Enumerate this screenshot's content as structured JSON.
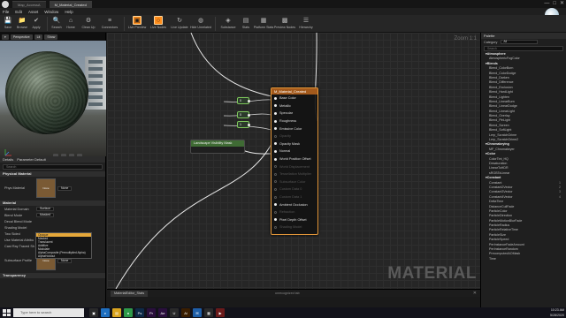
{
  "titlebar": {
    "tabs": [
      "Map_AccessA",
      "M_Material_Created"
    ],
    "controls": [
      "—",
      "□",
      "✕"
    ]
  },
  "menu": [
    "File",
    "Edit",
    "Asset",
    "Window",
    "Help"
  ],
  "toolbar": {
    "buttons": [
      {
        "label": "Save",
        "icon": "save-icon",
        "glyph": "💾",
        "hl": false
      },
      {
        "label": "Browse",
        "icon": "folder-icon",
        "glyph": "📁",
        "hl": false
      },
      {
        "label": "Apply",
        "icon": "apply-icon",
        "glyph": "✔",
        "hl": false
      },
      {
        "label": "Search",
        "icon": "search-icon",
        "glyph": "🔍",
        "hl": false
      },
      {
        "label": "Home",
        "icon": "home-icon",
        "glyph": "⌂",
        "hl": false
      },
      {
        "label": "Clean Up",
        "icon": "cleanup-icon",
        "glyph": "⚙",
        "hl": false
      },
      {
        "label": "Connectors",
        "icon": "connectors-icon",
        "glyph": "≡",
        "hl": false
      },
      {
        "label": "Live Preview",
        "icon": "live-preview-icon",
        "glyph": "▣",
        "hl": true
      },
      {
        "label": "Live Nodes",
        "icon": "live-nodes-icon",
        "glyph": "○",
        "hl": true
      },
      {
        "label": "Live Update",
        "icon": "live-update-icon",
        "glyph": "↻",
        "hl": false
      },
      {
        "label": "Hide Unrelated",
        "icon": "hide-unrelated-icon",
        "glyph": "◍",
        "hl": false
      },
      {
        "label": "Substance",
        "icon": "substance-icon",
        "glyph": "◈",
        "hl": false
      },
      {
        "label": "Stats",
        "icon": "stats-icon",
        "glyph": "▤",
        "hl": false
      },
      {
        "label": "Platform Stats",
        "icon": "platform-stats-icon",
        "glyph": "▦",
        "hl": false
      },
      {
        "label": "Preview Nodes",
        "icon": "preview-nodes-icon",
        "glyph": "▩",
        "hl": false
      },
      {
        "label": "Hierarchy",
        "icon": "hierarchy-icon",
        "glyph": "☰",
        "hl": false
      }
    ]
  },
  "viewport": {
    "buttons": [
      "▾",
      "Perspective",
      "Lit",
      "Show"
    ]
  },
  "details": {
    "tabs": [
      "Details",
      "Parameter Default"
    ],
    "search_placeholder": "Search",
    "sections": {
      "physical": "Physical Material",
      "material": "Material",
      "transparency": "Transparency"
    },
    "phys_label": "Phys Material",
    "phys_thumb": "None",
    "phys_value": "None",
    "rows": [
      {
        "label": "Material Domain",
        "value": "Surface"
      },
      {
        "label": "Blend Mode",
        "value": "Masked"
      },
      {
        "label": "Decal Blend Mode",
        "value": ""
      },
      {
        "label": "Shading Model",
        "value": ""
      },
      {
        "label": "Two Sided",
        "value": ""
      },
      {
        "label": "Use Material Attribu",
        "value": ""
      },
      {
        "label": "Cast Ray Traced Sh",
        "value": ""
      }
    ],
    "dropdown": [
      "Opaque",
      "Masked",
      "Translucent",
      "Additive",
      "Modulate",
      "AlphaComposite (Premultiplied Alpha)",
      "AlphaHoldout"
    ],
    "subsurface_label": "Subsurface Profile",
    "subsurface_thumb": "None",
    "subsurface_value": "None"
  },
  "graph": {
    "zoom": "Zoom 1:1",
    "watermark": "MATERIAL",
    "node_title": "M_Material_Created",
    "pins": [
      {
        "name": "Base Color",
        "on": true
      },
      {
        "name": "Metallic",
        "on": true
      },
      {
        "name": "Specular",
        "on": true
      },
      {
        "name": "Roughness",
        "on": true
      },
      {
        "name": "Emissive Color",
        "on": true
      },
      {
        "name": "Opacity",
        "on": false
      },
      {
        "name": "Opacity Mask",
        "on": true
      },
      {
        "name": "Normal",
        "on": true
      },
      {
        "name": "World Position Offset",
        "on": true
      },
      {
        "name": "World Displacement",
        "on": false
      },
      {
        "name": "Tessellation Multiplier",
        "on": false
      },
      {
        "name": "Subsurface Color",
        "on": false
      },
      {
        "name": "Custom Data 0",
        "on": false
      },
      {
        "name": "Custom Data 1",
        "on": false
      },
      {
        "name": "Ambient Occlusion",
        "on": true
      },
      {
        "name": "Refraction",
        "on": false
      },
      {
        "name": "Pixel Depth Offset",
        "on": true
      },
      {
        "name": "Shading Model",
        "on": false
      }
    ],
    "const_nodes": [
      "0",
      "0",
      "1"
    ],
    "mask_node_title": "Landscape Visibility Mask",
    "tab": "MaterialEditor_Stats",
    "center_text": "unrecognized tab"
  },
  "palette": {
    "tab": "Palette",
    "category_label": "Category",
    "category_value": "All",
    "search_placeholder": "Search",
    "items": [
      {
        "name": "▾Atmosphere",
        "cat": true,
        "key": ""
      },
      {
        "name": "AtmosphericFogColor",
        "cat": false,
        "key": ""
      },
      {
        "name": "▾Blends",
        "cat": true,
        "key": ""
      },
      {
        "name": "Blend_ColorBurn",
        "cat": false,
        "key": ""
      },
      {
        "name": "Blend_ColorDodge",
        "cat": false,
        "key": ""
      },
      {
        "name": "Blend_Darken",
        "cat": false,
        "key": ""
      },
      {
        "name": "Blend_Difference",
        "cat": false,
        "key": ""
      },
      {
        "name": "Blend_Exclusion",
        "cat": false,
        "key": ""
      },
      {
        "name": "Blend_HardLight",
        "cat": false,
        "key": ""
      },
      {
        "name": "Blend_Lighten",
        "cat": false,
        "key": ""
      },
      {
        "name": "Blend_LinearBurn",
        "cat": false,
        "key": ""
      },
      {
        "name": "Blend_LinearDodge",
        "cat": false,
        "key": ""
      },
      {
        "name": "Blend_LinearLight",
        "cat": false,
        "key": ""
      },
      {
        "name": "Blend_Overlay",
        "cat": false,
        "key": ""
      },
      {
        "name": "Blend_PinLight",
        "cat": false,
        "key": ""
      },
      {
        "name": "Blend_Screen",
        "cat": false,
        "key": ""
      },
      {
        "name": "Blend_SoftLight",
        "cat": false,
        "key": ""
      },
      {
        "name": "Lerp_ScratchGrime",
        "cat": false,
        "key": ""
      },
      {
        "name": "Lerp_ScratchGrime2",
        "cat": false,
        "key": ""
      },
      {
        "name": "▾Chromakeying",
        "cat": true,
        "key": ""
      },
      {
        "name": "MF_Chromakeyer",
        "cat": false,
        "key": ""
      },
      {
        "name": "▾Color",
        "cat": true,
        "key": ""
      },
      {
        "name": "ColorTint_HQ",
        "cat": false,
        "key": ""
      },
      {
        "name": "Desaturation",
        "cat": false,
        "key": ""
      },
      {
        "name": "LinearToHDR",
        "cat": false,
        "key": ""
      },
      {
        "name": "sRGBToLinear",
        "cat": false,
        "key": ""
      },
      {
        "name": "▾Constant",
        "cat": true,
        "key": ""
      },
      {
        "name": "Constant",
        "cat": false,
        "key": "1"
      },
      {
        "name": "Constant2Vector",
        "cat": false,
        "key": "2"
      },
      {
        "name": "Constant3Vector",
        "cat": false,
        "key": "3"
      },
      {
        "name": "Constant4Vector",
        "cat": false,
        "key": "4"
      },
      {
        "name": "DeltaTime",
        "cat": false,
        "key": ""
      },
      {
        "name": "DistanceCullFade",
        "cat": false,
        "key": ""
      },
      {
        "name": "ParticleColor",
        "cat": false,
        "key": ""
      },
      {
        "name": "ParticleDirection",
        "cat": false,
        "key": ""
      },
      {
        "name": "ParticleMotionBlurFade",
        "cat": false,
        "key": ""
      },
      {
        "name": "ParticleRadius",
        "cat": false,
        "key": ""
      },
      {
        "name": "ParticleRelativeTime",
        "cat": false,
        "key": ""
      },
      {
        "name": "ParticleSize",
        "cat": false,
        "key": ""
      },
      {
        "name": "ParticleSpeed",
        "cat": false,
        "key": ""
      },
      {
        "name": "PerInstanceFadeAmount",
        "cat": false,
        "key": ""
      },
      {
        "name": "PerInstanceRandom",
        "cat": false,
        "key": ""
      },
      {
        "name": "PrecomputedAOMask",
        "cat": false,
        "key": ""
      },
      {
        "name": "Time",
        "cat": false,
        "key": ""
      }
    ]
  },
  "taskbar": {
    "search_placeholder": "Type here to search",
    "apps": [
      {
        "icon": "task-view-icon",
        "glyph": "▣",
        "color": "#2a2a2a"
      },
      {
        "icon": "edge-icon",
        "glyph": "e",
        "color": "#1f6fbf"
      },
      {
        "icon": "explorer-icon",
        "glyph": "▤",
        "color": "#d9a420"
      },
      {
        "icon": "chrome-icon",
        "glyph": "●",
        "color": "#2f9a4a"
      },
      {
        "icon": "photoshop-icon",
        "glyph": "Ps",
        "color": "#0e2a47"
      },
      {
        "icon": "premiere-icon",
        "glyph": "Pr",
        "color": "#2a0f3d"
      },
      {
        "icon": "aftereffects-icon",
        "glyph": "Ae",
        "color": "#2a0f3d"
      },
      {
        "icon": "unreal-icon",
        "glyph": "U",
        "color": "#2a2a2a"
      },
      {
        "icon": "illustrator-icon",
        "glyph": "Ai",
        "color": "#3a1e00"
      },
      {
        "icon": "mail-icon",
        "glyph": "✉",
        "color": "#1f5fa8"
      },
      {
        "icon": "store-icon",
        "glyph": "▦",
        "color": "#2a2a2a"
      },
      {
        "icon": "media-icon",
        "glyph": "▶",
        "color": "#6a1a1a"
      }
    ],
    "time": "10:23 AM",
    "date": "5/28/2020"
  }
}
